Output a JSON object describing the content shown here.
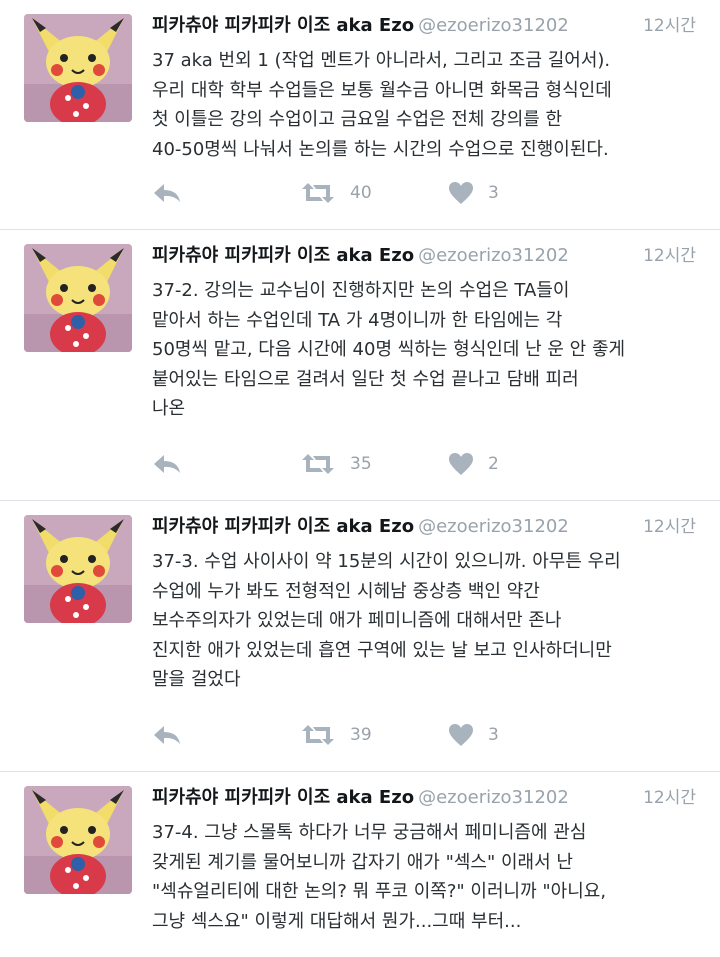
{
  "tweets": [
    {
      "display_name": "피카츄야 피카피카 이조 aka Ezo",
      "screen_name": "@ezoerizo31202",
      "time": "12시간",
      "text": "37 aka 번외 1 (작업 멘트가 아니라서, 그리고 조금 길어서).\n우리 대학 학부 수업들은 보통 월수금 아니면 화목금 형식인데\n첫 이틀은 강의 수업이고 금요일 수업은 전체 강의를 한\n40-50명씩 나눠서 논의를 하는 시간의 수업으로 진행이된다.",
      "retweets": "40",
      "likes": "3"
    },
    {
      "display_name": "피카츄야 피카피카 이조 aka Ezo",
      "screen_name": "@ezoerizo31202",
      "time": "12시간",
      "text": "37-2. 강의는 교수님이 진행하지만 논의 수업은 TA들이\n맡아서 하는 수업인데 TA 가 4명이니까 한 타임에는 각\n50명씩 맡고, 다음 시간에 40명 씩하는 형식인데 난 운 안 좋게\n붙어있는 타임으로 걸려서 일단 첫 수업 끝나고 담배 피러\n나온",
      "retweets": "35",
      "likes": "2"
    },
    {
      "display_name": "피카츄야 피카피카 이조 aka Ezo",
      "screen_name": "@ezoerizo31202",
      "time": "12시간",
      "text": "37-3. 수업 사이사이 약 15분의 시간이 있으니까. 아무튼 우리\n수업에 누가 봐도 전형적인 시헤남 중상층 백인 약간\n보수주의자가 있었는데 애가 페미니즘에 대해서만 존나\n진지한 애가 있었는데 흡연 구역에 있는 날 보고 인사하더니만\n말을 걸었다",
      "retweets": "39",
      "likes": "3"
    },
    {
      "display_name": "피카츄야 피카피카 이조 aka Ezo",
      "screen_name": "@ezoerizo31202",
      "time": "12시간",
      "text": "37-4. 그냥 스몰톡 하다가 너무 궁금해서 페미니즘에 관심\n갖게된 계기를 물어보니까 갑자기 애가 \"섹스\" 이래서 난\n\"섹슈얼리티에 대한 논의? 뭐 푸코 이쪽?\" 이러니까 \"아니요,\n그냥 섹스요\" 이렇게 대답해서 뭔가...그때 부터...",
      "retweets": "",
      "likes": ""
    }
  ],
  "colors": {
    "text": "#292f33",
    "name": "#14171a",
    "muted": "#99a2ab",
    "icon": "#a8b3bd",
    "divider": "#dfe3e8"
  },
  "icons": [
    "reply-icon",
    "retweet-icon",
    "like-icon",
    "avatar-pikachu-plush"
  ]
}
